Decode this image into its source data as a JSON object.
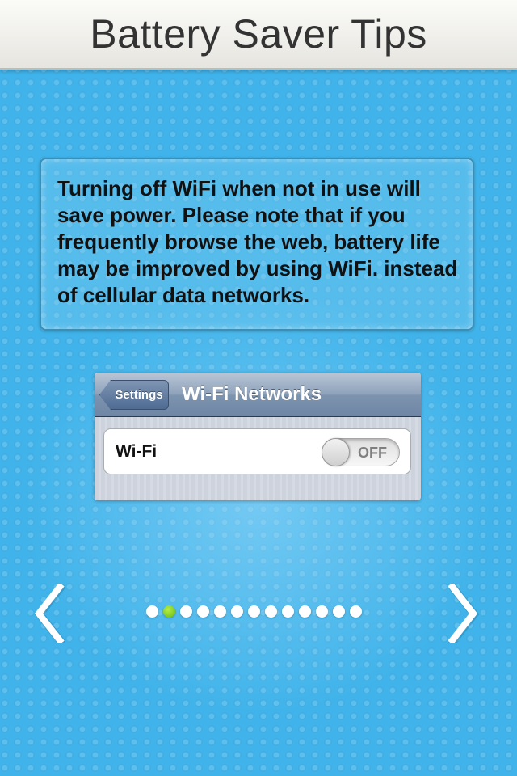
{
  "header": {
    "title": "Battery Saver Tips"
  },
  "tip": {
    "text": "Turning off WiFi when not in use will save power. Please note that if you frequently browse the web, battery life may be improved by using WiFi. instead of cellular data networks."
  },
  "illustration": {
    "back_label": "Settings",
    "nav_title": "Wi-Fi Networks",
    "row_label": "Wi-Fi",
    "toggle_label": "OFF"
  },
  "pager": {
    "total_pages": 13,
    "current_page": 2,
    "active_color": "#7ed321"
  },
  "icons": {
    "previous": "chevron-left-icon",
    "next": "chevron-right-icon"
  }
}
